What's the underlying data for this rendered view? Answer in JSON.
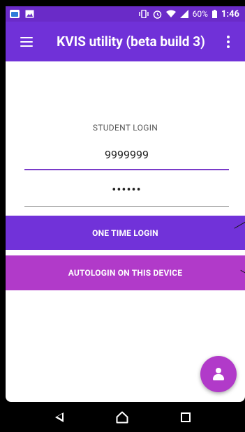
{
  "status_bar": {
    "battery_percent": "60%",
    "time": "1:46",
    "icons": [
      "app-icon",
      "gallery-icon",
      "vibrate-icon",
      "alarm-icon",
      "wifi-icon",
      "signal-icon",
      "battery-icon"
    ]
  },
  "app_bar": {
    "title": "KVIS utility (beta build 3)",
    "menu_icon": "hamburger-menu-icon",
    "overflow_icon": "more-vert-icon"
  },
  "login": {
    "section_title": "STUDENT LOGIN",
    "username_value": "9999999",
    "password_masked": "••••••"
  },
  "buttons": {
    "one_time_login": "ONE TIME LOGIN",
    "autologin": "AUTOLOGIN ON THIS DEVICE"
  },
  "fab": {
    "icon": "person-icon"
  },
  "nav_bar": {
    "icons": [
      "back-icon",
      "home-icon",
      "recents-icon"
    ]
  },
  "colors": {
    "primary": "#7031d8",
    "accent": "#b13ac9",
    "statusbar": "#6a2bc8"
  }
}
